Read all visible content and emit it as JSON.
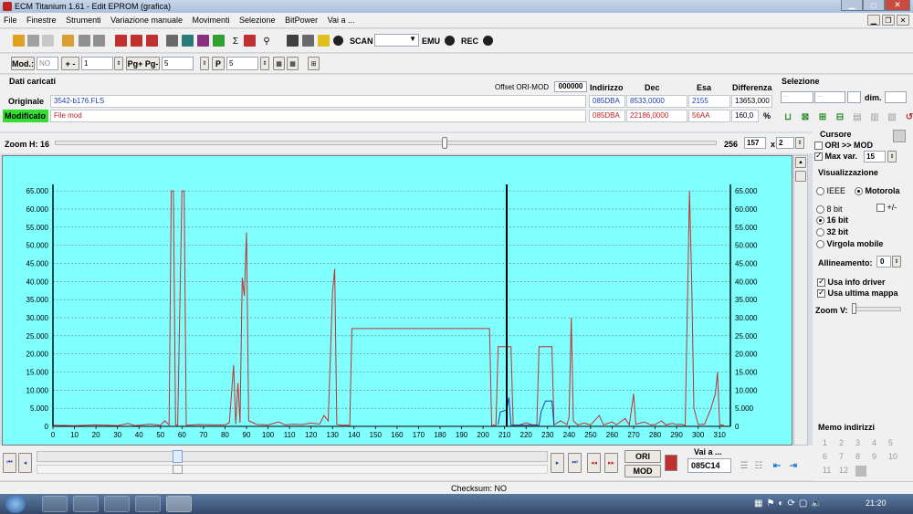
{
  "window": {
    "title": "ECM Titanium 1.61 - Edit EPROM (grafica)"
  },
  "menu": [
    "File",
    "Finestre",
    "Strumenti",
    "Variazione manuale",
    "Movimenti",
    "Selezione",
    "BitPower",
    "Vai a ..."
  ],
  "toolbar2": {
    "scan_label": "SCAN",
    "emu_label": "EMU",
    "rec_label": "REC"
  },
  "toolbar3": {
    "mod_label": "Mod.:",
    "mod_value": "NO",
    "plusminus_label": "+ -",
    "step_value": "1",
    "pg_label": "Pg+ Pg-",
    "pg_value": "5",
    "p_value": "5"
  },
  "data": {
    "section_title": "Dati caricati",
    "offset_label": "Offset ORI-MOD",
    "offset_value": "000000",
    "headers": {
      "indirizzo": "Indirizzo",
      "dec": "Dec",
      "esa": "Esa",
      "differenza": "Differenza"
    },
    "original": {
      "label": "Originale",
      "file": "3542-b176.FLS",
      "indirizzo": "085DBA",
      "dec": "8533,0000",
      "esa": "2155",
      "differenza": "13653,000"
    },
    "modified": {
      "label": "Modificato",
      "file": "File mod",
      "indirizzo": "085DBA",
      "dec": "22186,0000",
      "esa": "56AA",
      "differenza": "160,0",
      "pct": "%"
    }
  },
  "selezione": {
    "title": "Selezione",
    "f1": "...",
    "f2": "...",
    "dim_label": "dim."
  },
  "zoom": {
    "label": "Zoom H: 16",
    "value": "256",
    "field": "157",
    "x_label": "x",
    "mult": "2"
  },
  "cursore": {
    "title": "Cursore",
    "ori_mod": "ORI >> MOD",
    "max_var_label": "Max var.",
    "max_var_value": "15"
  },
  "visualizzazione": {
    "title": "Visualizzazione",
    "ieee": "IEEE",
    "motorola": "Motorola",
    "bit8": "8 bit",
    "plusminus": "+/-",
    "bit16": "16 bit",
    "bit32": "32 bit",
    "float": "Virgola mobile",
    "allineamento_label": "Allineamento:",
    "allineamento_value": "0",
    "usa_info": "Usa info driver",
    "usa_ultima": "Usa ultima mappa",
    "zoomv_label": "Zoom V:"
  },
  "memo": {
    "title": "Memo indirizzi",
    "items": [
      "1",
      "2",
      "3",
      "4",
      "5",
      "6",
      "7",
      "8",
      "9",
      "10",
      "11",
      "12"
    ]
  },
  "bottom": {
    "vai_label": "Vai a ...",
    "vai_value": "085C14",
    "ori_label": "ORI",
    "mod_label": "MOD"
  },
  "status": {
    "checksum": "Checksum: NO"
  },
  "clock": "21:20",
  "colors": {
    "chart_bg": "#80ffff",
    "original_line": "#c03030",
    "modified_line": "#1a3fb3",
    "modificato_bg": "#33dd33"
  },
  "chart_data": {
    "type": "line",
    "xlim": [
      0,
      315
    ],
    "ylim": [
      0,
      65535
    ],
    "x_ticks": [
      0,
      10,
      20,
      30,
      40,
      50,
      60,
      70,
      80,
      90,
      100,
      110,
      120,
      130,
      140,
      150,
      160,
      170,
      180,
      190,
      200,
      210,
      220,
      230,
      240,
      250,
      260,
      270,
      280,
      290,
      300,
      310
    ],
    "y_ticks": [
      "0",
      "5.000",
      "10.000",
      "15.000",
      "20.000",
      "25.000",
      "30.000",
      "35.000",
      "40.000",
      "45.000",
      "50.000",
      "55.000",
      "60.000",
      "65.000"
    ],
    "y_tick_values": [
      0,
      5000,
      10000,
      15000,
      20000,
      25000,
      30000,
      35000,
      40000,
      45000,
      50000,
      55000,
      60000,
      65000
    ],
    "cursor_x": 211,
    "series": [
      {
        "color": "#c03030",
        "points": [
          [
            0,
            300
          ],
          [
            10,
            200
          ],
          [
            20,
            400
          ],
          [
            30,
            200
          ],
          [
            35,
            800
          ],
          [
            38,
            200
          ],
          [
            45,
            600
          ],
          [
            50,
            300
          ],
          [
            52,
            1500
          ],
          [
            54,
            400
          ],
          [
            55,
            65000
          ],
          [
            56,
            65000
          ],
          [
            57,
            400
          ],
          [
            58,
            300
          ],
          [
            60,
            65000
          ],
          [
            61,
            65000
          ],
          [
            62,
            300
          ],
          [
            68,
            500
          ],
          [
            75,
            400
          ],
          [
            80,
            400
          ],
          [
            82,
            1000
          ],
          [
            84,
            17000
          ],
          [
            85,
            600
          ],
          [
            86,
            12000
          ],
          [
            87,
            1000
          ],
          [
            88,
            41000
          ],
          [
            89,
            36000
          ],
          [
            90,
            53500
          ],
          [
            91,
            1500
          ],
          [
            93,
            1000
          ],
          [
            95,
            500
          ],
          [
            100,
            400
          ],
          [
            105,
            1200
          ],
          [
            108,
            400
          ],
          [
            112,
            600
          ],
          [
            116,
            500
          ],
          [
            120,
            900
          ],
          [
            124,
            600
          ],
          [
            126,
            3000
          ],
          [
            128,
            1500
          ],
          [
            130,
            37000
          ],
          [
            131,
            43500
          ],
          [
            132,
            500
          ],
          [
            134,
            300
          ],
          [
            136,
            300
          ],
          [
            138,
            300
          ],
          [
            139,
            27000
          ],
          [
            203,
            27000
          ],
          [
            204,
            300
          ],
          [
            206,
            300
          ],
          [
            207,
            22000
          ],
          [
            213,
            22000
          ],
          [
            214,
            300
          ],
          [
            217,
            400
          ],
          [
            220,
            1000
          ],
          [
            223,
            400
          ],
          [
            225,
            400
          ],
          [
            226,
            22000
          ],
          [
            232,
            22000
          ],
          [
            233,
            400
          ],
          [
            236,
            1500
          ],
          [
            239,
            500
          ],
          [
            240,
            2500
          ],
          [
            241,
            30000
          ],
          [
            242,
            1500
          ],
          [
            244,
            400
          ],
          [
            247,
            900
          ],
          [
            250,
            400
          ],
          [
            254,
            3000
          ],
          [
            256,
            400
          ],
          [
            260,
            1200
          ],
          [
            262,
            400
          ],
          [
            266,
            2200
          ],
          [
            268,
            400
          ],
          [
            270,
            9000
          ],
          [
            271,
            600
          ],
          [
            275,
            1200
          ],
          [
            278,
            400
          ],
          [
            280,
            500
          ],
          [
            283,
            1500
          ],
          [
            285,
            400
          ],
          [
            288,
            800
          ],
          [
            290,
            500
          ],
          [
            292,
            600
          ],
          [
            294,
            300
          ],
          [
            296,
            65000
          ],
          [
            297,
            40000
          ],
          [
            298,
            5000
          ],
          [
            300,
            500
          ],
          [
            303,
            600
          ],
          [
            306,
            5000
          ],
          [
            308,
            9000
          ],
          [
            309,
            15000
          ],
          [
            310,
            400
          ],
          [
            312,
            300
          ]
        ]
      },
      {
        "color": "#1a3fb3",
        "points": [
          [
            207,
            500
          ],
          [
            208,
            4000
          ],
          [
            211,
            4500
          ],
          [
            212,
            8000
          ],
          [
            213,
            300
          ],
          [
            226,
            300
          ],
          [
            227,
            4000
          ],
          [
            229,
            7000
          ],
          [
            232,
            7000
          ],
          [
            233,
            300
          ]
        ]
      }
    ]
  }
}
